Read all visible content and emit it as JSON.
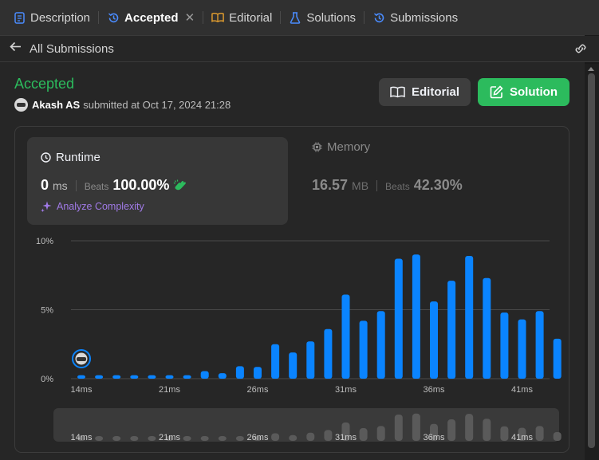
{
  "tabs": [
    {
      "label": "Description",
      "icon": "document-icon",
      "active": false
    },
    {
      "label": "Accepted",
      "icon": "history-icon",
      "active": true
    },
    {
      "label": "Editorial",
      "icon": "book-icon",
      "active": false
    },
    {
      "label": "Solutions",
      "icon": "flask-icon",
      "active": false
    },
    {
      "label": "Submissions",
      "icon": "history-icon",
      "active": false
    }
  ],
  "subheader": {
    "back_label": "All Submissions"
  },
  "submission": {
    "status": "Accepted",
    "author": "Akash AS",
    "submitted_text": "submitted at Oct 17, 2024 21:28"
  },
  "buttons": {
    "editorial": "Editorial",
    "solution": "Solution"
  },
  "runtime": {
    "title": "Runtime",
    "value": "0",
    "unit": "ms",
    "beats_label": "Beats",
    "beats_value": "100.00%",
    "analyze_label": "Analyze Complexity"
  },
  "memory": {
    "title": "Memory",
    "value": "16.57",
    "unit": "MB",
    "beats_label": "Beats",
    "beats_value": "42.30%"
  },
  "colors": {
    "accepted": "#2cbb5d",
    "bar": "#0a84ff",
    "analyze": "#a07ae6"
  },
  "chart_data": {
    "type": "bar",
    "y_ticks": [
      "10%",
      "5%",
      "0%"
    ],
    "ylim": [
      0,
      10
    ],
    "x_tick_labels": [
      "14ms",
      "21ms",
      "26ms",
      "31ms",
      "36ms",
      "41ms"
    ],
    "x_tick_index": [
      0,
      5,
      10,
      15,
      20,
      25
    ],
    "values": [
      0.25,
      0.25,
      0.25,
      0.25,
      0.25,
      0.25,
      0.25,
      0.55,
      0.4,
      0.9,
      0.85,
      2.5,
      1.9,
      2.7,
      3.6,
      6.1,
      4.2,
      4.9,
      8.7,
      9.0,
      5.6,
      7.1,
      8.9,
      7.3,
      4.8,
      4.3,
      4.9,
      2.9
    ],
    "highlight_index": 0,
    "grid": true
  }
}
